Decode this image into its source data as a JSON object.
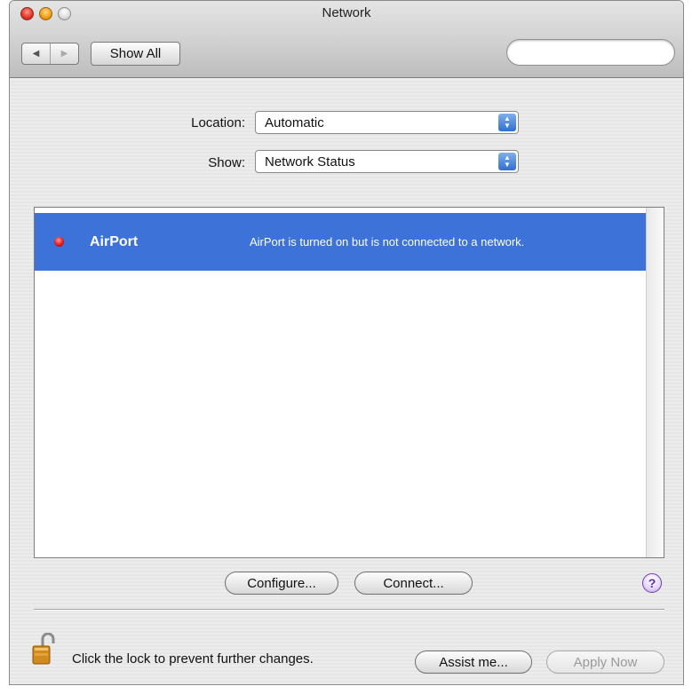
{
  "window": {
    "title": "Network"
  },
  "toolbar": {
    "back_icon": "back-arrow",
    "forward_icon": "forward-arrow",
    "show_all_label": "Show All",
    "search": {
      "value": "",
      "placeholder": ""
    }
  },
  "form": {
    "location_label": "Location:",
    "location_value": "Automatic",
    "show_label": "Show:",
    "show_value": "Network Status"
  },
  "services": [
    {
      "name": "AirPort",
      "status": "AirPort is turned on but is not connected to a network.",
      "status_color": "#e0191b",
      "selected": true
    }
  ],
  "actions": {
    "configure_label": "Configure...",
    "connect_label": "Connect...",
    "help_label": "?"
  },
  "footer": {
    "lock_text": "Click the lock to prevent further changes.",
    "assist_label": "Assist me...",
    "apply_label": "Apply Now"
  },
  "colors": {
    "selection": "#3d72d8",
    "window_bg": "#ececec"
  }
}
